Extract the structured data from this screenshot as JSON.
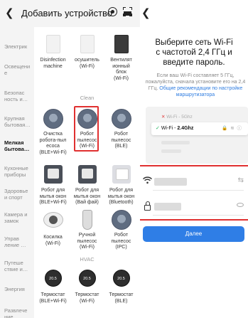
{
  "left": {
    "header": {
      "back_icon": "chevron-left-icon",
      "title": "Добавить устройство",
      "target_icon": "target-icon",
      "scan_icon": "scan-icon"
    },
    "categories": [
      {
        "label": "Электрик"
      },
      {
        "label": "Освещени\nе"
      },
      {
        "label": "Безопас\nность и…"
      },
      {
        "label": "Крупная\nбытовая…"
      },
      {
        "label": "Мелкая\nбытова…",
        "active": true
      },
      {
        "label": "Кухонные\nприборы"
      },
      {
        "label": "Здоровье\nи спорт"
      },
      {
        "label": "Камера и\nзамок"
      },
      {
        "label": "Управ\nление …"
      },
      {
        "label": "Путеше\nствие и…"
      },
      {
        "label": "Энергия"
      },
      {
        "label": "Развлече\nние"
      }
    ],
    "top_devices": [
      {
        "label": "Disinfection\nmachine",
        "icon": "disinfection-machine-icon"
      },
      {
        "label": "осушитель\n(Wi-Fi)",
        "icon": "dehumidifier-icon"
      },
      {
        "label": "Вентилят\nионный\nблок\n(Wi-Fi)",
        "icon": "ventilation-unit-icon"
      }
    ],
    "section_clean": "Clean",
    "clean_devices": [
      {
        "label": "Очистка\nробота-пыл\nесоса\n(BLE+Wi-Fi)",
        "icon": "robot-vacuum-icon"
      },
      {
        "label": "Робот\nпылесос\n(Wi-Fi)",
        "icon": "robot-vacuum-icon"
      },
      {
        "label": "Робот\nпылесос\n(BLE)",
        "icon": "robot-vacuum-icon"
      },
      {
        "label": "Робот для\nмытья окон\n(BLE+Wi-Fi)",
        "icon": "window-robot-icon"
      },
      {
        "label": "Робот для\nмытья окон\n(Вай фай)",
        "icon": "window-robot-icon"
      },
      {
        "label": "Робот для\nмытья окон\n(Bluetooth)",
        "icon": "window-robot-icon"
      },
      {
        "label": "Косилка\n(Wi-Fi)",
        "icon": "mower-icon"
      },
      {
        "label": "Ручной\nпылесос\n(Wi-Fi)",
        "icon": "handheld-vacuum-icon"
      },
      {
        "label": "Робот\nпылесос\n(IPC)",
        "icon": "robot-vacuum-icon"
      }
    ],
    "section_hvac": "HVAC",
    "hvac_devices": [
      {
        "label": "Термостат\n(BLE+Wi-Fi)",
        "icon": "thermostat-icon",
        "display": "20.5"
      },
      {
        "label": "Термостат\n(Wi-Fi)",
        "icon": "thermostat-icon",
        "display": "20.5"
      },
      {
        "label": "Термостат\n(BLE)",
        "icon": "thermostat-icon",
        "display": "20.5"
      }
    ]
  },
  "right": {
    "back_icon": "chevron-left-icon",
    "heading": "Выберите сеть Wi-Fi\nс частотой 2,4 ГГц и\nвведите пароль.",
    "desc": "Если ваш Wi-Fi составляет 5 ГГц, пожалуйста, сначала установите его на 2,4 ГГц.",
    "desc_link": "Общие рекомендации по настройке маршрутизатора",
    "illustration": {
      "row_5g": "Wi-Fi - 5Ghz",
      "row_24_prefix": "Wi-Fi - ",
      "row_24_band": "2.4Ghz",
      "row_24_icons": "🔒 ≋ ⓘ"
    },
    "wifi_field_icon": "wifi-icon",
    "swap_icon": "swap-icon",
    "password_field_icon": "lock-icon",
    "eye_icon": "eye-icon",
    "next_button": "Далее",
    "colors": {
      "accent": "#2f7ee6",
      "highlight": "#e03030",
      "check": "#1db35a"
    }
  }
}
